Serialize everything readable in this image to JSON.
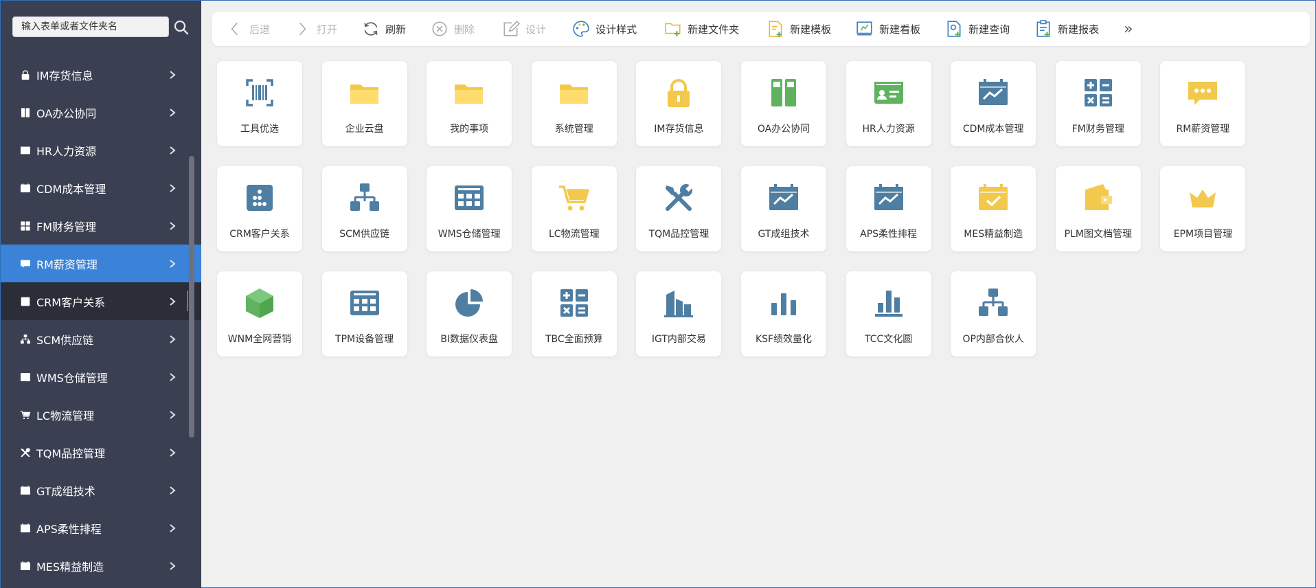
{
  "colors": {
    "sidebar_bg": "#3b3f52",
    "active_bg": "#3b83d8",
    "hover_bg": "#2b2d38",
    "content_bg": "#f0f0f0",
    "icon_blue": "#4f7ea3",
    "icon_yellow": "#f2c94c",
    "icon_green": "#5fb35f"
  },
  "sidebar": {
    "search_placeholder": "输入表单或者文件夹名",
    "items": [
      {
        "label": "IM存货信息",
        "icon": "lock-icon",
        "state": ""
      },
      {
        "label": "OA办公协同",
        "icon": "binder-icon",
        "state": ""
      },
      {
        "label": "HR人力资源",
        "icon": "id-card-icon",
        "state": ""
      },
      {
        "label": "CDM成本管理",
        "icon": "chart-board-icon",
        "state": ""
      },
      {
        "label": "FM财务管理",
        "icon": "calculator-icon",
        "state": ""
      },
      {
        "label": "RM薪资管理",
        "icon": "chat-bubble-icon",
        "state": "active"
      },
      {
        "label": "CRM客户关系",
        "icon": "dots-square-icon",
        "state": "hover"
      },
      {
        "label": "SCM供应链",
        "icon": "org-chart-icon",
        "state": ""
      },
      {
        "label": "WMS仓储管理",
        "icon": "grid-table-icon",
        "state": ""
      },
      {
        "label": "LC物流管理",
        "icon": "cart-icon",
        "state": ""
      },
      {
        "label": "TQM品控管理",
        "icon": "tools-icon",
        "state": ""
      },
      {
        "label": "GT成组技术",
        "icon": "chart-board-icon",
        "state": ""
      },
      {
        "label": "APS柔性排程",
        "icon": "chart-board-icon",
        "state": ""
      },
      {
        "label": "MES精益制造",
        "icon": "check-board-icon",
        "state": ""
      }
    ]
  },
  "toolbar": {
    "buttons": [
      {
        "label": "后退",
        "icon": "chevron-left-icon",
        "disabled": true
      },
      {
        "label": "打开",
        "icon": "chevron-right-icon",
        "disabled": true
      },
      {
        "label": "刷新",
        "icon": "refresh-icon",
        "disabled": false
      },
      {
        "label": "删除",
        "icon": "delete-circle-icon",
        "disabled": true
      },
      {
        "label": "设计",
        "icon": "edit-icon",
        "disabled": true
      },
      {
        "label": "设计样式",
        "icon": "palette-icon",
        "disabled": false
      },
      {
        "label": "新建文件夹",
        "icon": "new-folder-icon",
        "disabled": false
      },
      {
        "label": "新建模板",
        "icon": "new-template-icon",
        "disabled": false
      },
      {
        "label": "新建看板",
        "icon": "new-board-icon",
        "disabled": false
      },
      {
        "label": "新建查询",
        "icon": "new-query-icon",
        "disabled": false
      },
      {
        "label": "新建报表",
        "icon": "new-report-icon",
        "disabled": false
      }
    ],
    "more": "»"
  },
  "tiles": [
    {
      "label": "工具优选",
      "icon": "barcode-scan-icon",
      "color": "#4f7ea3"
    },
    {
      "label": "企业云盘",
      "icon": "folder-icon",
      "color": "#f2c94c"
    },
    {
      "label": "我的事项",
      "icon": "folder-icon",
      "color": "#f2c94c"
    },
    {
      "label": "系统管理",
      "icon": "folder-icon",
      "color": "#f2c94c"
    },
    {
      "label": "IM存货信息",
      "icon": "lock-icon",
      "color": "#f2c94c"
    },
    {
      "label": "OA办公协同",
      "icon": "binder-icon",
      "color": "#5fb35f"
    },
    {
      "label": "HR人力资源",
      "icon": "id-card-icon",
      "color": "#5fb35f"
    },
    {
      "label": "CDM成本管理",
      "icon": "chart-board-icon",
      "color": "#4f7ea3"
    },
    {
      "label": "FM财务管理",
      "icon": "calculator-icon",
      "color": "#4f7ea3"
    },
    {
      "label": "RM薪资管理",
      "icon": "chat-bubble-icon",
      "color": "#f2c94c"
    },
    {
      "label": "CRM客户关系",
      "icon": "dots-square-icon",
      "color": "#4f7ea3"
    },
    {
      "label": "SCM供应链",
      "icon": "org-chart-icon",
      "color": "#4f7ea3"
    },
    {
      "label": "WMS仓储管理",
      "icon": "grid-table-icon",
      "color": "#4f7ea3"
    },
    {
      "label": "LC物流管理",
      "icon": "cart-icon",
      "color": "#f2c94c"
    },
    {
      "label": "TQM品控管理",
      "icon": "tools-icon",
      "color": "#4f7ea3"
    },
    {
      "label": "GT成组技术",
      "icon": "chart-board-icon",
      "color": "#4f7ea3"
    },
    {
      "label": "APS柔性排程",
      "icon": "chart-board-icon",
      "color": "#4f7ea3"
    },
    {
      "label": "MES精益制造",
      "icon": "check-board-icon",
      "color": "#f2c94c"
    },
    {
      "label": "PLM图文档管理",
      "icon": "wallet-icon",
      "color": "#f2c94c"
    },
    {
      "label": "EPM项目管理",
      "icon": "crown-icon",
      "color": "#f2c94c"
    },
    {
      "label": "WNM全网营销",
      "icon": "cube-icon",
      "color": "#5fb35f"
    },
    {
      "label": "TPM设备管理",
      "icon": "grid-table-icon",
      "color": "#4f7ea3"
    },
    {
      "label": "BI数据仪表盘",
      "icon": "pie-chart-icon",
      "color": "#4f7ea3"
    },
    {
      "label": "TBC全面预算",
      "icon": "calculator-icon",
      "color": "#4f7ea3"
    },
    {
      "label": "IGT内部交易",
      "icon": "buildings-icon",
      "color": "#4f7ea3"
    },
    {
      "label": "KSF绩效量化",
      "icon": "bar-chart-icon",
      "color": "#4f7ea3"
    },
    {
      "label": "TCC文化圆",
      "icon": "podium-chart-icon",
      "color": "#4f7ea3"
    },
    {
      "label": "OP内部合伙人",
      "icon": "org-chart-icon",
      "color": "#4f7ea3"
    }
  ]
}
